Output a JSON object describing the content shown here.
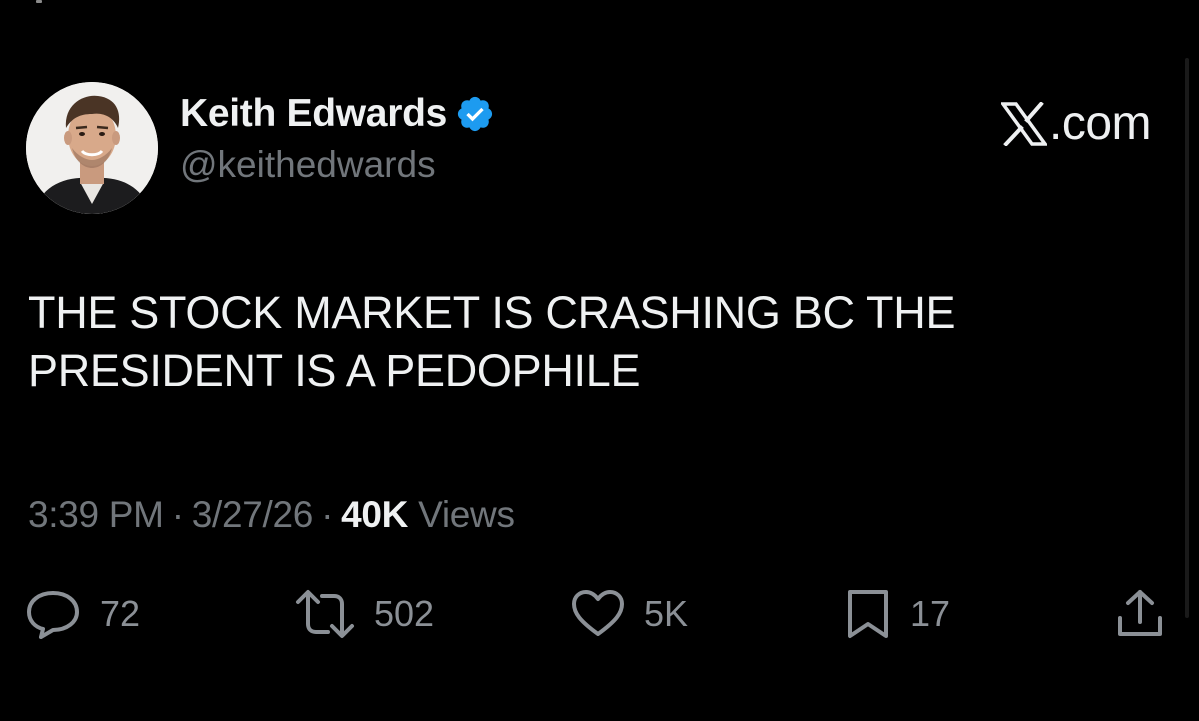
{
  "author": {
    "display_name": "Keith Edwards",
    "handle": "@keithedwards",
    "verified_icon": "verified-badge-icon",
    "avatar_icon": "profile-photo"
  },
  "brand": {
    "label": ".com",
    "icon": "x-logo-icon"
  },
  "tweet": {
    "text": "THE STOCK MARKET IS CRASHING BC THE PRESIDENT IS A PEDOPHILE",
    "time": "3:39 PM",
    "separator_1": "·",
    "date": "3/27/26",
    "separator_2": "·",
    "views_count": "40K",
    "views_label": "Views"
  },
  "actions": {
    "reply": {
      "icon": "reply-icon",
      "count": "72"
    },
    "repost": {
      "icon": "repost-icon",
      "count": "502"
    },
    "like": {
      "icon": "heart-icon",
      "count": "5K"
    },
    "bookmark": {
      "icon": "bookmark-icon",
      "count": "17"
    },
    "share": {
      "icon": "share-icon"
    }
  },
  "colors": {
    "background": "#000000",
    "primary_text": "#eff1f2",
    "secondary_text": "#71767b",
    "verified_blue": "#1d9bf0"
  }
}
